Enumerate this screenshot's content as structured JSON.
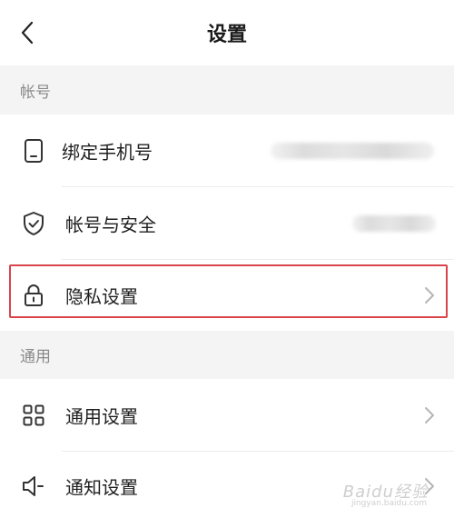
{
  "header": {
    "title": "设置",
    "back_icon": "chevron-left-icon"
  },
  "sections": [
    {
      "label": "帐号",
      "items": [
        {
          "label": "绑定手机号",
          "icon": "phone-icon",
          "value_blurred": true
        },
        {
          "label": "帐号与安全",
          "icon": "shield-check-icon",
          "value_blurred": true
        },
        {
          "label": "隐私设置",
          "icon": "lock-icon",
          "highlighted": true
        }
      ]
    },
    {
      "label": "通用",
      "items": [
        {
          "label": "通用设置",
          "icon": "grid-icon"
        },
        {
          "label": "通知设置",
          "icon": "speaker-icon"
        }
      ]
    }
  ],
  "watermark": {
    "text": "Baidu经验",
    "sub": "jingyan.baidu.com"
  },
  "colors": {
    "highlight": "#d9454a",
    "background": "#f4f4f4"
  }
}
